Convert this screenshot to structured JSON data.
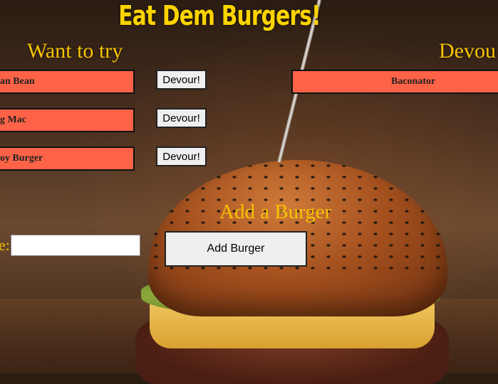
{
  "page": {
    "title": "Eat Dem Burgers!"
  },
  "want_to_try": {
    "heading": "Want to try",
    "items": [
      {
        "name": "an Bean",
        "button": "Devour!"
      },
      {
        "name": "g Mac",
        "button": "Devour!"
      },
      {
        "name": "oy Burger",
        "button": "Devour!"
      }
    ]
  },
  "devoured": {
    "heading": "Devou",
    "items": [
      {
        "name": "Baconator"
      }
    ]
  },
  "add_form": {
    "heading": "Add a Burger",
    "label": "e:",
    "input_value": "",
    "button": "Add Burger"
  }
}
